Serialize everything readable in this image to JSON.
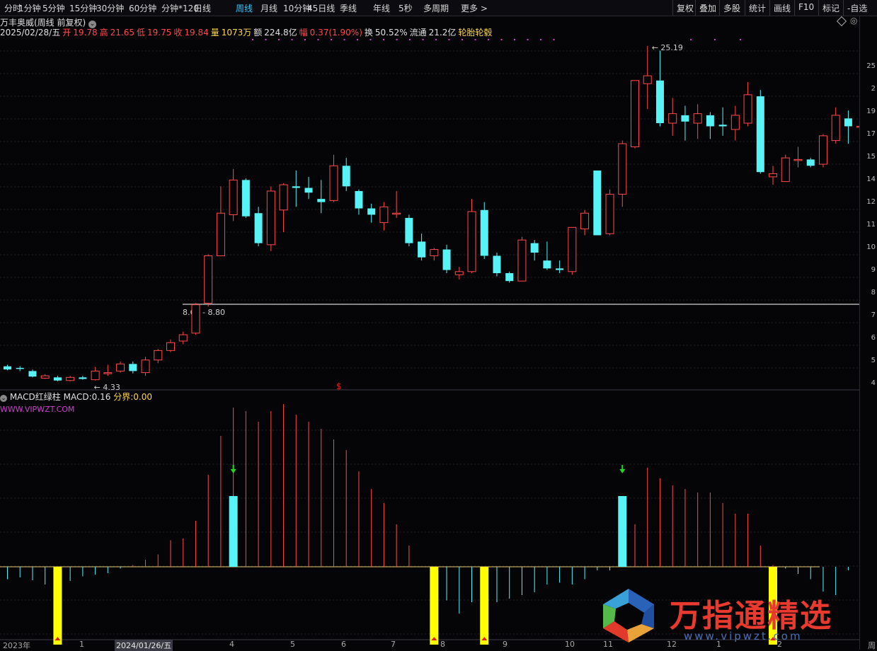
{
  "toolbar": {
    "periods": [
      "分时",
      "1分钟",
      "5分钟",
      "15分钟",
      "30分钟",
      "60分钟",
      "分钟*120",
      "日线",
      "周线",
      "月线",
      "10分钟",
      "45日线",
      "季线",
      "年线",
      "5秒",
      "多周期",
      "更多 >"
    ],
    "active_index": 8,
    "right_tools": [
      "复权",
      "叠加",
      "多股",
      "统计",
      "画线",
      "F10",
      "标记",
      "-自选"
    ]
  },
  "header": {
    "stock_name": "万丰奥威(周线 前复权)",
    "date": "2025/02/28/五",
    "open_label": "开",
    "open": "19.78",
    "high_label": "高",
    "high": "21.65",
    "low_label": "低",
    "low": "19.75",
    "close_label": "收",
    "close": "19.84",
    "vol_label": "量",
    "volume": "1073万",
    "amt_label": "额",
    "amount": "224.8亿",
    "chg_label": "幅",
    "change": "0.37(1.90%)",
    "turn_label": "换",
    "turnover": "50.52%",
    "float_label": "流通",
    "float_cap": "21.2亿",
    "concept": "轮胎轮毂"
  },
  "annotations": {
    "max_label": "25.19",
    "min_label": "4.33",
    "range_label": "8.68 - 8.80",
    "signal_glyph": "$"
  },
  "price_axis": [
    "25",
    "2",
    "19",
    "17",
    "15",
    "14",
    "12",
    "11",
    "10",
    "9",
    "8",
    "7",
    "6",
    "5",
    "4"
  ],
  "indicator": {
    "name": "MACD红绿柱",
    "macd_label": "MACD:",
    "macd": "0.16",
    "fen_label": "分界:",
    "fen": "0.00",
    "url": "WWW.VIPWZT.COM"
  },
  "time_axis": [
    "2023年",
    "1",
    "2024/01/26/五",
    "4",
    "5",
    "6",
    "7",
    "8",
    "9",
    "10",
    "11",
    "12",
    "1",
    "2",
    "周"
  ],
  "watermark": {
    "text": "万指通精选",
    "url": "www.vipwzt.com"
  },
  "colors": {
    "up": "#ff4a4a",
    "down": "#58f3f6",
    "signal": "#ffff00",
    "purple": "#d040d0"
  },
  "chart_data": {
    "type": "candlestick",
    "candles": [
      {
        "o": 4.9,
        "c": 4.7,
        "h": 5.0,
        "l": 4.65
      },
      {
        "o": 4.8,
        "c": 4.75,
        "h": 4.9,
        "l": 4.6
      },
      {
        "o": 4.6,
        "c": 4.25,
        "h": 4.7,
        "l": 4.2
      },
      {
        "o": 4.15,
        "c": 4.3,
        "h": 4.4,
        "l": 4.1
      },
      {
        "o": 4.2,
        "c": 4.0,
        "h": 4.3,
        "l": 3.95
      },
      {
        "o": 4.0,
        "c": 4.2,
        "h": 4.3,
        "l": 3.95
      },
      {
        "o": 4.2,
        "c": 4.1,
        "h": 4.3,
        "l": 4.05
      },
      {
        "o": 4.05,
        "c": 4.6,
        "h": 4.85,
        "l": 4.0
      },
      {
        "o": 4.5,
        "c": 4.5,
        "h": 5.0,
        "l": 4.3
      },
      {
        "o": 4.6,
        "c": 5.05,
        "h": 5.2,
        "l": 4.5
      },
      {
        "o": 5.05,
        "c": 4.6,
        "h": 5.2,
        "l": 4.45
      },
      {
        "o": 4.5,
        "c": 5.3,
        "h": 5.5,
        "l": 4.3
      },
      {
        "o": 5.3,
        "c": 5.9,
        "h": 6.0,
        "l": 5.1
      },
      {
        "o": 5.9,
        "c": 6.4,
        "h": 6.6,
        "l": 5.8
      },
      {
        "o": 6.5,
        "c": 6.9,
        "h": 7.1,
        "l": 6.3
      },
      {
        "o": 7.0,
        "c": 8.8,
        "h": 8.9,
        "l": 6.9
      },
      {
        "o": 8.9,
        "c": 11.9,
        "h": 12.0,
        "l": 8.68
      },
      {
        "o": 11.9,
        "c": 14.6,
        "h": 16.3,
        "l": 11.9
      },
      {
        "o": 14.5,
        "c": 16.7,
        "h": 17.4,
        "l": 14.1
      },
      {
        "o": 16.7,
        "c": 14.4,
        "h": 16.8,
        "l": 14.3
      },
      {
        "o": 14.6,
        "c": 12.7,
        "h": 15.0,
        "l": 12.5
      },
      {
        "o": 12.6,
        "c": 16.0,
        "h": 16.3,
        "l": 12.2
      },
      {
        "o": 14.8,
        "c": 16.4,
        "h": 16.5,
        "l": 13.4
      },
      {
        "o": 16.3,
        "c": 16.2,
        "h": 17.3,
        "l": 15.0
      },
      {
        "o": 16.2,
        "c": 15.9,
        "h": 16.9,
        "l": 15.5
      },
      {
        "o": 15.5,
        "c": 15.3,
        "h": 16.7,
        "l": 14.6
      },
      {
        "o": 15.4,
        "c": 17.6,
        "h": 18.3,
        "l": 15.3
      },
      {
        "o": 17.6,
        "c": 16.3,
        "h": 18.1,
        "l": 16.0
      },
      {
        "o": 16.0,
        "c": 14.9,
        "h": 16.1,
        "l": 14.5
      },
      {
        "o": 14.9,
        "c": 14.5,
        "h": 15.2,
        "l": 14.0
      },
      {
        "o": 14.0,
        "c": 15.0,
        "h": 15.3,
        "l": 13.5
      },
      {
        "o": 14.6,
        "c": 14.6,
        "h": 16.0,
        "l": 14.3
      },
      {
        "o": 14.3,
        "c": 12.7,
        "h": 14.5,
        "l": 12.5
      },
      {
        "o": 12.8,
        "c": 11.8,
        "h": 13.3,
        "l": 11.6
      },
      {
        "o": 11.9,
        "c": 12.3,
        "h": 12.4,
        "l": 11.6
      },
      {
        "o": 12.3,
        "c": 11.0,
        "h": 12.6,
        "l": 10.8
      },
      {
        "o": 10.7,
        "c": 10.9,
        "h": 11.2,
        "l": 10.4
      },
      {
        "o": 10.9,
        "c": 14.7,
        "h": 15.5,
        "l": 10.8
      },
      {
        "o": 14.8,
        "c": 11.9,
        "h": 15.3,
        "l": 11.7
      },
      {
        "o": 11.9,
        "c": 10.8,
        "h": 12.1,
        "l": 10.6
      },
      {
        "o": 10.8,
        "c": 10.3,
        "h": 10.9,
        "l": 10.2
      },
      {
        "o": 10.3,
        "c": 12.9,
        "h": 13.1,
        "l": 10.3
      },
      {
        "o": 12.7,
        "c": 12.1,
        "h": 12.9,
        "l": 11.6
      },
      {
        "o": 11.6,
        "c": 11.1,
        "h": 12.8,
        "l": 11.0
      },
      {
        "o": 11.1,
        "c": 11.0,
        "h": 11.6,
        "l": 10.8
      },
      {
        "o": 10.9,
        "c": 13.7,
        "h": 13.7,
        "l": 10.7
      },
      {
        "o": 13.6,
        "c": 14.6,
        "h": 14.8,
        "l": 13.2
      },
      {
        "o": 17.3,
        "c": 13.2,
        "h": 17.3,
        "l": 13.2
      },
      {
        "o": 13.3,
        "c": 15.8,
        "h": 16.1,
        "l": 13.2
      },
      {
        "o": 15.8,
        "c": 19.0,
        "h": 19.2,
        "l": 15.0
      },
      {
        "o": 18.8,
        "c": 23.0,
        "h": 23.0,
        "l": 18.7
      },
      {
        "o": 22.8,
        "c": 23.3,
        "h": 25.19,
        "l": 21.2
      },
      {
        "o": 23.0,
        "c": 20.3,
        "h": 24.9,
        "l": 20.1
      },
      {
        "o": 20.3,
        "c": 20.9,
        "h": 21.9,
        "l": 19.5
      },
      {
        "o": 20.8,
        "c": 20.4,
        "h": 21.4,
        "l": 19.2
      },
      {
        "o": 20.3,
        "c": 20.9,
        "h": 21.5,
        "l": 19.3
      },
      {
        "o": 20.8,
        "c": 20.1,
        "h": 21.0,
        "l": 19.3
      },
      {
        "o": 20.2,
        "c": 20.1,
        "h": 21.3,
        "l": 19.5
      },
      {
        "o": 19.9,
        "c": 20.8,
        "h": 21.4,
        "l": 19.2
      },
      {
        "o": 20.3,
        "c": 22.1,
        "h": 22.9,
        "l": 20.1
      },
      {
        "o": 22.0,
        "c": 17.2,
        "h": 22.4,
        "l": 17.1
      },
      {
        "o": 16.9,
        "c": 17.1,
        "h": 17.6,
        "l": 16.4
      },
      {
        "o": 16.6,
        "c": 18.1,
        "h": 18.3,
        "l": 16.6
      },
      {
        "o": 18.0,
        "c": 18.0,
        "h": 18.8,
        "l": 17.5
      },
      {
        "o": 18.0,
        "c": 17.6,
        "h": 18.1,
        "l": 17.5
      },
      {
        "o": 17.7,
        "c": 19.5,
        "h": 19.6,
        "l": 17.5
      },
      {
        "o": 19.2,
        "c": 20.8,
        "h": 21.3,
        "l": 19.0
      },
      {
        "o": 20.6,
        "c": 20.1,
        "h": 21.1,
        "l": 19.0
      },
      {
        "o": 20.1,
        "c": 20.1,
        "h": 21.9,
        "l": 19.5
      }
    ],
    "support_price": 8.8,
    "macd": [
      -0.35,
      -0.3,
      -0.38,
      -0.5,
      -0.42,
      -0.4,
      -0.27,
      -0.22,
      -0.18,
      -0.05,
      0.05,
      0.2,
      0.35,
      0.75,
      0.8,
      1.3,
      2.6,
      3.7,
      4.5,
      4.4,
      4.1,
      4.4,
      4.6,
      4.3,
      4.1,
      3.9,
      3.6,
      3.3,
      2.7,
      2.2,
      1.8,
      1.2,
      0.6,
      0,
      -0.5,
      -0.95,
      -1.32,
      -1.0,
      -0.9,
      -1.0,
      -0.9,
      -0.8,
      -0.72,
      -0.5,
      -0.45,
      -0.5,
      -0.35,
      -0.1,
      -0.1,
      0.2,
      1.2,
      2.8,
      2.5,
      2.3,
      2.2,
      2.1,
      2.1,
      1.8,
      1.5,
      1.5,
      0.6,
      0.05,
      -0.05,
      -0.2,
      -0.35,
      -0.7,
      -0.8,
      -0.1,
      0.16
    ],
    "signals": [
      {
        "i": 4,
        "type": "yellow",
        "v": -2.2
      },
      {
        "i": 18,
        "type": "cyan",
        "v": 2.0
      },
      {
        "i": 34,
        "type": "yellow",
        "v": -2.2
      },
      {
        "i": 38,
        "type": "yellow",
        "v": -2.2
      },
      {
        "i": 49,
        "type": "cyan",
        "v": 2.0
      },
      {
        "i": 61,
        "type": "yellow",
        "v": -2.2
      }
    ]
  }
}
